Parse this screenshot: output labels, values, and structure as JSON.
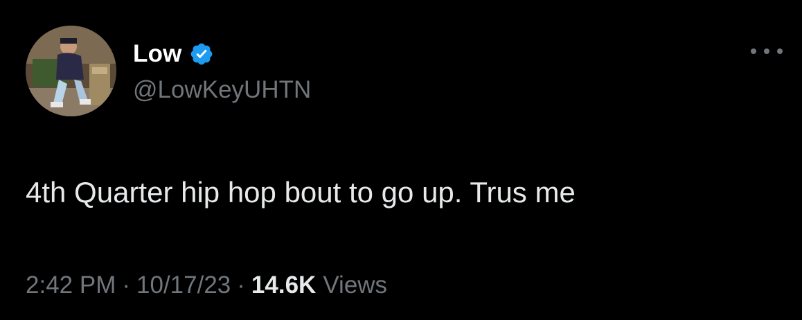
{
  "author": {
    "display_name": "Low",
    "handle": "@LowKeyUHTN",
    "verified": true,
    "avatar_icon": "profile-photo"
  },
  "tweet": {
    "text": "4th Quarter hip hop bout to go up. Trus me"
  },
  "meta": {
    "time": "2:42 PM",
    "separator": "·",
    "date": "10/17/23",
    "views_count": "14.6K",
    "views_label": "Views"
  },
  "icons": {
    "verified_badge": "verified-badge-icon",
    "more": "more-options-icon"
  },
  "colors": {
    "background": "#000000",
    "primary_text": "#e7e9ea",
    "secondary_text": "#71767b",
    "verified_blue": "#1d9bf0"
  }
}
